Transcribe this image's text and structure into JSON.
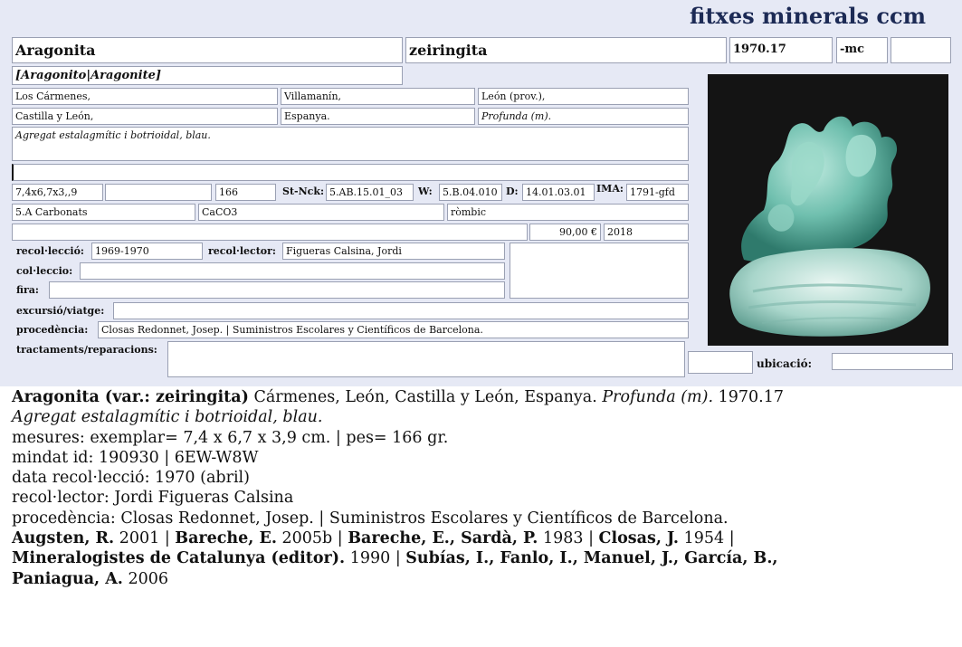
{
  "header": {
    "brand": "fitxes minerals ccm"
  },
  "card": {
    "name": "Aragonita",
    "variety": "zeiringita",
    "number": "1970.17",
    "suffix": "-mc",
    "synonyms": "[Aragonito|Aragonite]",
    "loc1": "Los Cármenes,",
    "loc2": "Villamanín,",
    "loc3": "León (prov.),",
    "loc4": "Castilla y León,",
    "loc5": "Espanya.",
    "loc6": "Profunda (m).",
    "description": "Agregat estalagmític i botrioidal, blau.",
    "dims": "7,4x6,7x3,,9",
    "weight": "166",
    "strunz_label": "St-Nck:",
    "strunz": "5.AB.15.01_03",
    "w_label": "W:",
    "w": "5.B.04.010",
    "d_label": "D:",
    "d": "14.01.03.01",
    "ima_label": "IMA:",
    "ima": "1791-gfd",
    "class": "5.A Carbonats",
    "formula": "CaCO3",
    "crystal": "ròmbic",
    "price": "90,00 €",
    "year": "2018",
    "recoleccio_label": "recol·lecció:",
    "recoleccio": "1969-1970",
    "recolector_label": "recol·lector:",
    "recolector": "Figueras Calsina, Jordi",
    "colleccio_label": "col·leccio:",
    "fira_label": "fira:",
    "excursio_label": "excursió/viatge:",
    "procedencia_label": "procedència:",
    "procedencia": "Closas Redonnet, Josep. | Suministros Escolares y Científicos de Barcelona.",
    "tractaments_label": "tractaments/reparacions:",
    "ubicacio_label": "ubicació:"
  },
  "desc": {
    "title": "Aragonita (var.: zeiringita)",
    "locality": " Cármenes, León, Castilla y León, Espanya. ",
    "locality_it": "Profunda (m).",
    "number": " 1970.17",
    "line2": "Agregat estalagmític i botrioidal, blau.",
    "line3": "mesures: exemplar= 7,4 x 6,7 x 3,9 cm. | pes= 166 gr.",
    "line4": "mindat id: 190930 | 6EW-W8W",
    "line5": "data recol·lecció: 1970 (abril)",
    "line6": "recol·lector: Jordi Figueras Calsina",
    "line7": "procedència: Closas Redonnet, Josep. | Suministros Escolares y Científicos de Barcelona.",
    "refs": [
      {
        "author": "Augsten, R.",
        "year": " 2001"
      },
      {
        "author": "Bareche, E.",
        "year": " 2005b"
      },
      {
        "author": "Bareche, E., Sardà, P.",
        "year": " 1983"
      },
      {
        "author": "Closas, J.",
        "year": " 1954"
      },
      {
        "author": "Mineralogistes de Catalunya (editor).",
        "year": " 1990"
      },
      {
        "author": "Subías, I., Fanlo, I., Manuel, J., García, B.,",
        "year": ""
      },
      {
        "author": "Paniagua, A.",
        "year": " 2006"
      }
    ],
    "sep": " | "
  }
}
